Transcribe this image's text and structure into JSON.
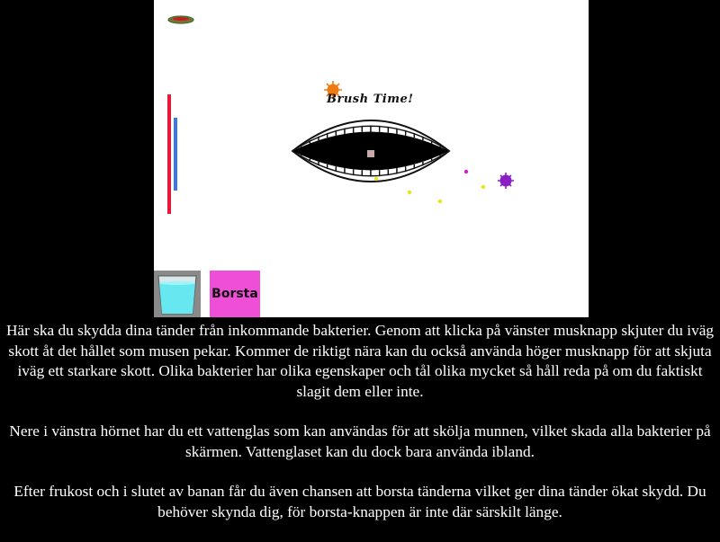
{
  "game": {
    "title": "Brush Time!",
    "brush_button_label": "Borsta",
    "colors": {
      "health_bar": "#e8183a",
      "shield_bar": "#3a78e8",
      "brush_button_bg": "#ee4fd6",
      "water": "#67e8f0",
      "enemy_purple": "#8a1fc4",
      "enemy_orange": "#f07a12",
      "pellet_yellow": "#e5e51a",
      "pellet_magenta": "#cc22cc",
      "cursor": "#c8a8a8"
    },
    "icons": {
      "water_button": "water-glass-icon",
      "top_left": "bacteria-icon"
    }
  },
  "instructions": {
    "paragraph_1": "Här ska du skydda dina tänder från inkommande bakterier. Genom att klicka på vänster musknapp skjuter du iväg skott åt det hållet som musen pekar. Kommer de riktigt nära kan du också använda höger musknapp för att skjuta iväg ett starkare skott. Olika bakterier har olika egenskaper och tål olika mycket så håll reda på om du faktiskt slagit dem eller inte.",
    "paragraph_2": "Nere i vänstra hörnet har du ett vattenglas som kan användas för att skölja munnen, vilket skada alla bakterier på skärmen. Vattenglaset kan du dock bara använda ibland.",
    "paragraph_3": "Efter frukost och i slutet av banan får du även chansen att borsta tänderna vilket ger dina tänder ökat skydd. Du behöver skynda dig, för borsta-knappen är inte där särskilt länge."
  }
}
